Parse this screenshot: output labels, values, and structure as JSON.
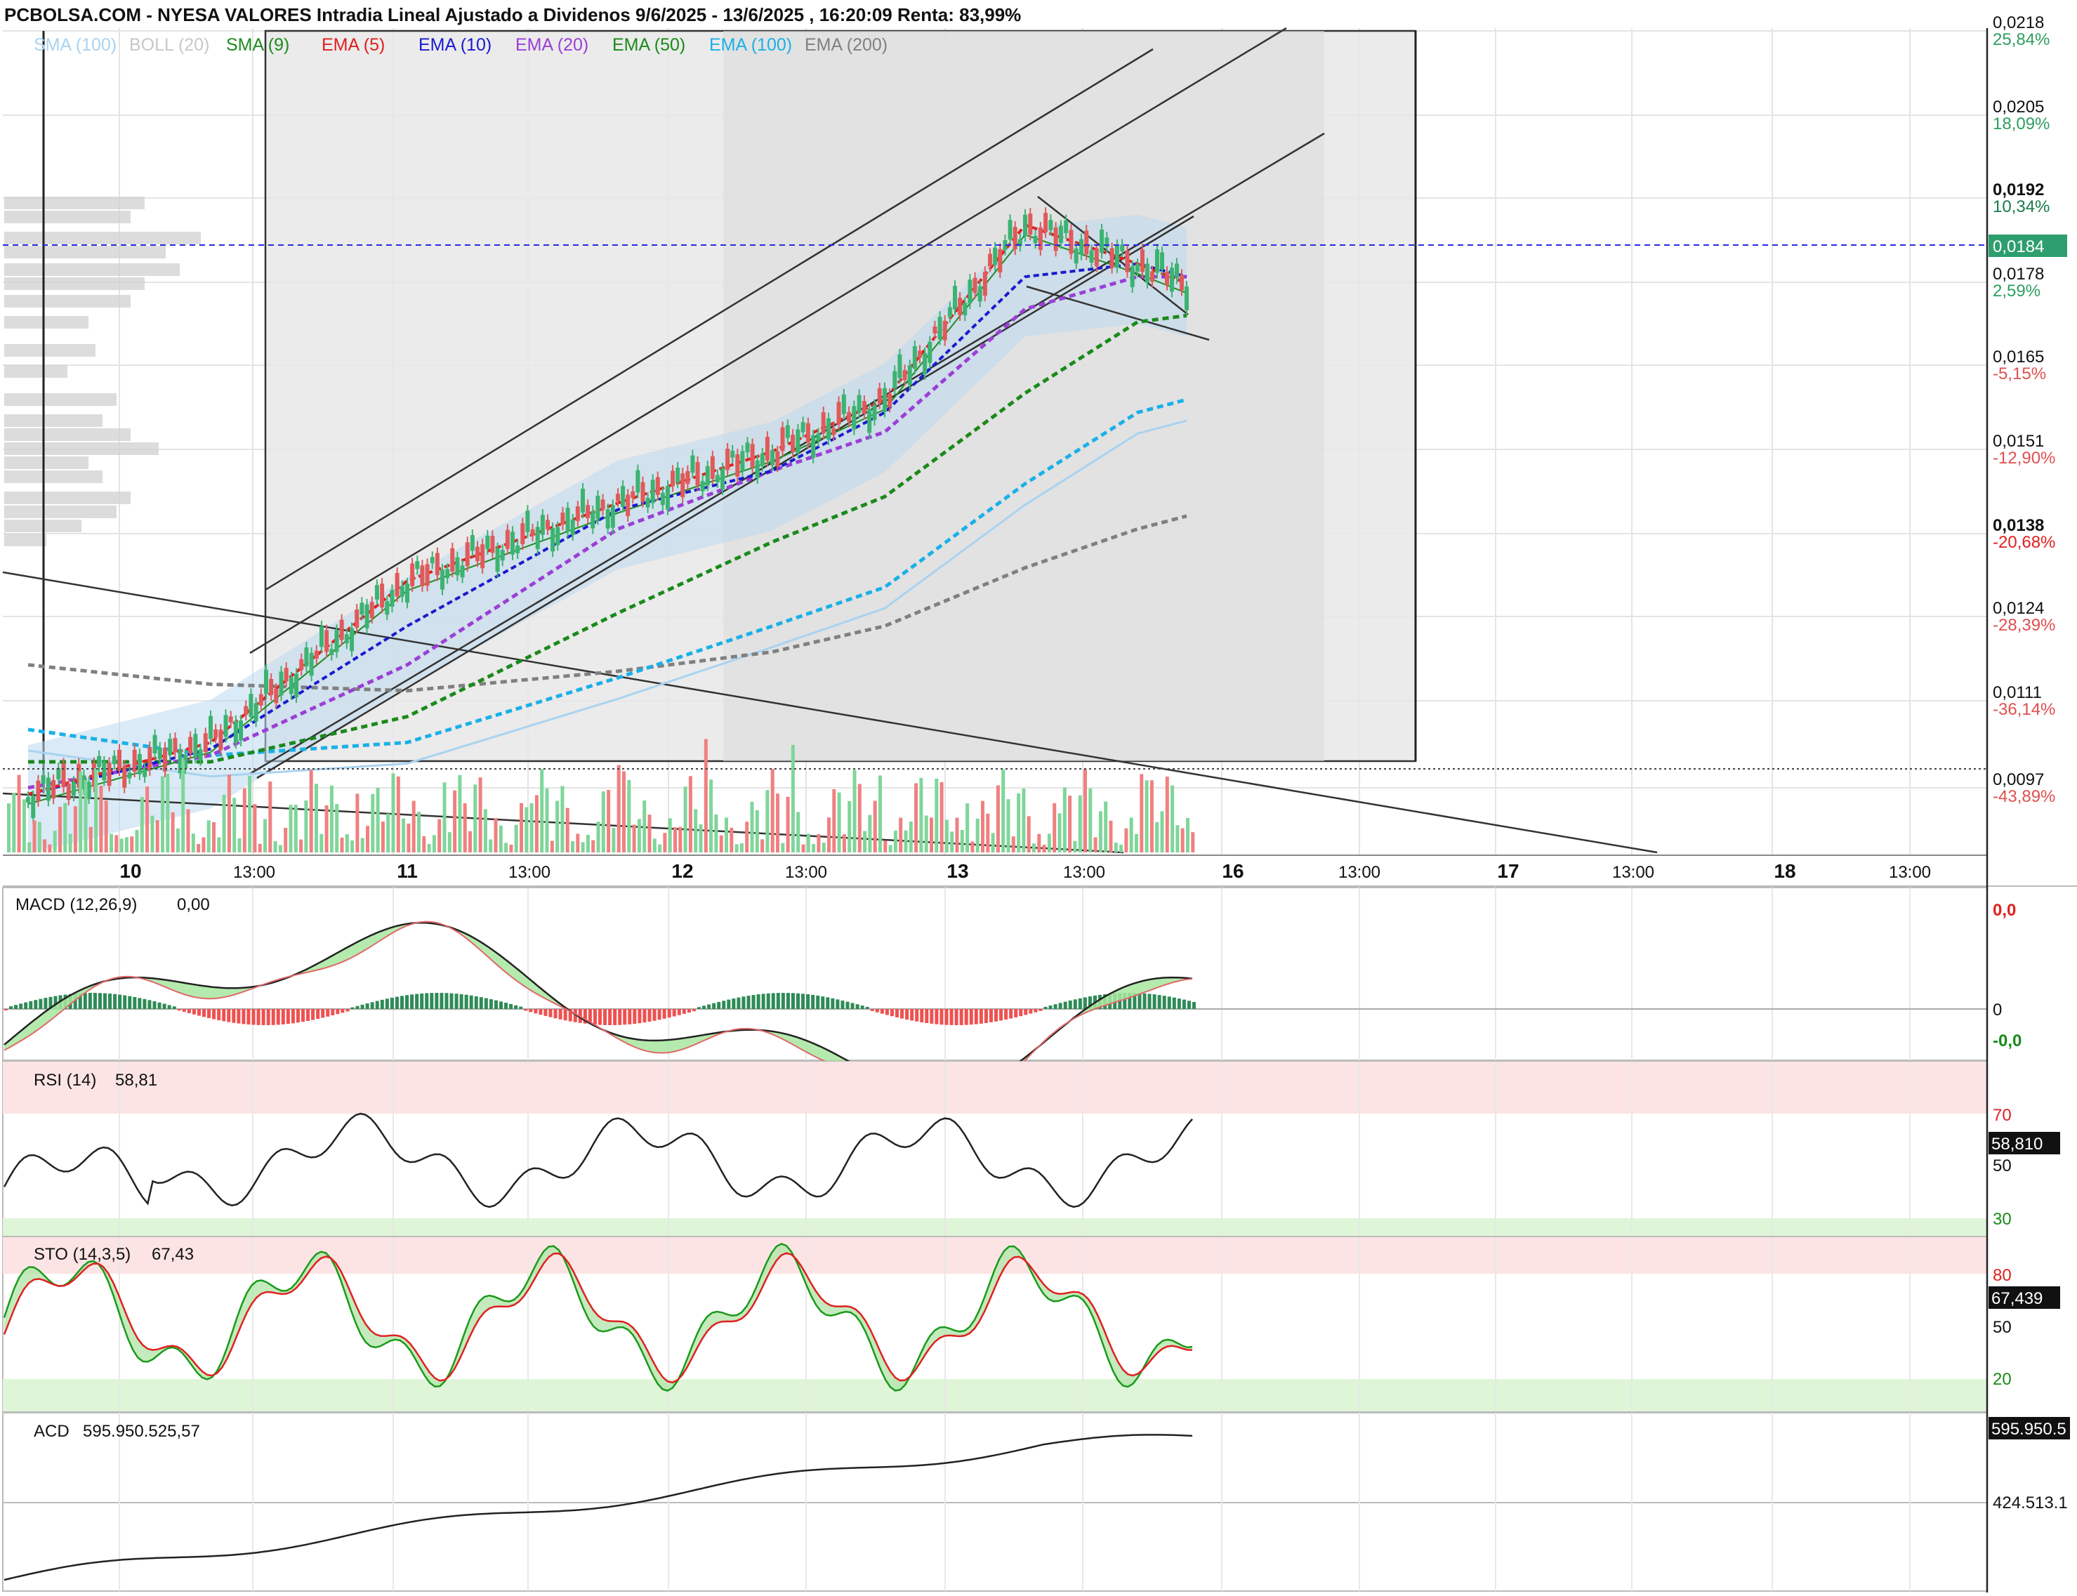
{
  "header": {
    "title": "PCBOLSA.COM - NYESA VALORES Intradia Lineal Ajustado a Dividenos 9/6/2025 - 13/6/2025 , 16:20:09 Renta: 83,99%"
  },
  "legend": [
    {
      "label": "SMA (100)",
      "color": "#a9d3f0"
    },
    {
      "label": "BOLL (20)",
      "color": "#c8c8c8"
    },
    {
      "label": "SMA (9)",
      "color": "#1e8c1e"
    },
    {
      "label": "EMA (5)",
      "color": "#e02020"
    },
    {
      "label": "EMA (10)",
      "color": "#1a1ad0"
    },
    {
      "label": "EMA (20)",
      "color": "#9b3fd6"
    },
    {
      "label": "EMA (50)",
      "color": "#1a8a1a"
    },
    {
      "label": "EMA (100)",
      "color": "#1ab0e8"
    },
    {
      "label": "EMA (200)",
      "color": "#808080"
    }
  ],
  "price_axis": [
    {
      "price": "0,0218",
      "pct": "25,84%",
      "pct_color": "#2e9e5e"
    },
    {
      "price": "0,0205",
      "pct": "18,09%",
      "pct_color": "#2e9e5e"
    },
    {
      "price": "0,0192",
      "pct": "10,34%",
      "pct_color": "#1a7a4a"
    },
    {
      "price": "0,0178",
      "pct": "2,59%",
      "pct_color": "#2e9e5e"
    },
    {
      "price": "0,0165",
      "pct": "-5,15%",
      "pct_color": "#e05050"
    },
    {
      "price": "0,0151",
      "pct": "-12,90%",
      "pct_color": "#e05050"
    },
    {
      "price": "0,0138",
      "pct": "-20,68%",
      "pct_color": "#e02020"
    },
    {
      "price": "0,0124",
      "pct": "-28,39%",
      "pct_color": "#e05050"
    },
    {
      "price": "0,0111",
      "pct": "-36,14%",
      "pct_color": "#e05050"
    },
    {
      "price": "0,0097",
      "pct": "-43,89%",
      "pct_color": "#e05050"
    }
  ],
  "current_price": {
    "label": "0,0184",
    "value": 0.0184,
    "color": "#2e9e6e"
  },
  "time_axis": [
    {
      "label": "10",
      "bold": true
    },
    {
      "label": "13:00",
      "bold": false
    },
    {
      "label": "11",
      "bold": true
    },
    {
      "label": "13:00",
      "bold": false
    },
    {
      "label": "12",
      "bold": true
    },
    {
      "label": "13:00",
      "bold": false
    },
    {
      "label": "13",
      "bold": true
    },
    {
      "label": "13:00",
      "bold": false
    },
    {
      "label": "16",
      "bold": true
    },
    {
      "label": "13:00",
      "bold": false
    },
    {
      "label": "17",
      "bold": true
    },
    {
      "label": "13:00",
      "bold": false
    },
    {
      "label": "18",
      "bold": true
    },
    {
      "label": "13:00",
      "bold": false
    }
  ],
  "macd": {
    "label": "MACD (12,26,9)",
    "value": "0,00",
    "axis": [
      "0,0",
      "0",
      "-0,0"
    ]
  },
  "rsi": {
    "label": "RSI (14)",
    "value": "58,81",
    "badge": "58,810",
    "axis": [
      "70",
      "50",
      "30"
    ]
  },
  "sto": {
    "label": "STO (14,3,5)",
    "value": "67,43",
    "badge": "67,439",
    "axis": [
      "80",
      "50",
      "20"
    ]
  },
  "acd": {
    "label": "ACD",
    "value": "595.950.525,57",
    "badge": "595.950.5",
    "axis": [
      "424.513.1"
    ]
  },
  "chart_data": {
    "type": "line",
    "title": "PCBOLSA.COM - NYESA VALORES Intradia Lineal Ajustado a Dividenos 9/6/2025 - 13/6/2025 , 16:20:09 Renta: 83,99%",
    "xlabel": "",
    "ylabel": "",
    "ylim": [
      0.0091,
      0.0218
    ],
    "grid": true,
    "x": [
      "10",
      "10 13:00",
      "11",
      "11 13:00",
      "12",
      "12 13:00",
      "13",
      "13 13:00",
      "13 16:20"
    ],
    "series": [
      {
        "name": "EMA (5)",
        "values": [
          0.01,
          0.0108,
          0.0133,
          0.0145,
          0.0153,
          0.0161,
          0.0188,
          0.0182,
          0.0179
        ]
      },
      {
        "name": "EMA (10)",
        "values": [
          0.01,
          0.0107,
          0.0126,
          0.0144,
          0.015,
          0.0159,
          0.018,
          0.0182,
          0.018
        ]
      },
      {
        "name": "EMA (20)",
        "values": [
          0.0101,
          0.0106,
          0.012,
          0.0141,
          0.015,
          0.0156,
          0.0175,
          0.018,
          0.018
        ]
      },
      {
        "name": "EMA (50)",
        "values": [
          0.0105,
          0.0105,
          0.0112,
          0.0128,
          0.0139,
          0.0146,
          0.0162,
          0.0173,
          0.0174
        ]
      },
      {
        "name": "EMA (100)",
        "values": [
          0.011,
          0.0106,
          0.0108,
          0.0118,
          0.0126,
          0.0132,
          0.0148,
          0.0159,
          0.0161
        ]
      },
      {
        "name": "EMA (200)",
        "values": [
          0.012,
          0.0117,
          0.0116,
          0.0119,
          0.0122,
          0.0126,
          0.0135,
          0.0141,
          0.0143
        ]
      }
    ],
    "last_price": 0.0184,
    "rsi_last": 58.81,
    "sto_last": 67.43,
    "macd_last": 0.0,
    "acd_last": 595950525.57
  }
}
